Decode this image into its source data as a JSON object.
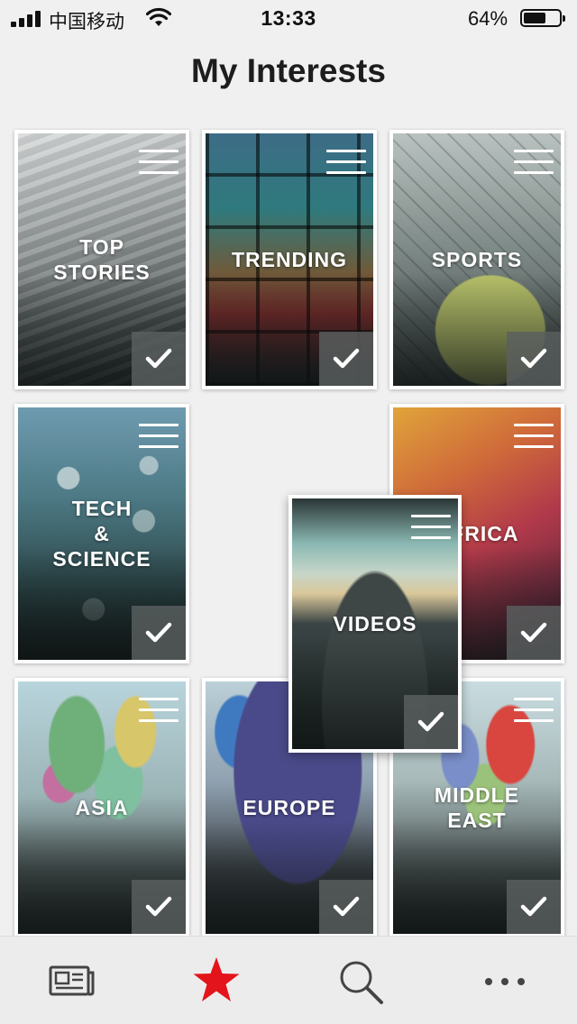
{
  "status_bar": {
    "carrier": "中国移动",
    "time": "13:33",
    "battery_percent_label": "64%",
    "battery_level": 0.64
  },
  "page": {
    "title": "My Interests"
  },
  "tiles": [
    {
      "label": "TOP\nSTORIES",
      "checked": true
    },
    {
      "label": "TRENDING",
      "checked": true
    },
    {
      "label": "SPORTS",
      "checked": true
    },
    {
      "label": "TECH\n&\nSCIENCE",
      "checked": true
    },
    {
      "label": "AFRICA",
      "checked": true
    },
    {
      "label": "ASIA",
      "checked": true
    },
    {
      "label": "EUROPE",
      "checked": true
    },
    {
      "label": "MIDDLE\nEAST",
      "checked": true
    }
  ],
  "dragging_tile": {
    "label": "VIDEOS",
    "checked": true
  },
  "tab_bar": {
    "tabs": [
      {
        "icon": "newspaper-icon",
        "active": false
      },
      {
        "icon": "star-icon",
        "active": true
      },
      {
        "icon": "search-icon",
        "active": false
      },
      {
        "icon": "more-icon",
        "active": false
      }
    ],
    "active_color": "#e3141b"
  }
}
